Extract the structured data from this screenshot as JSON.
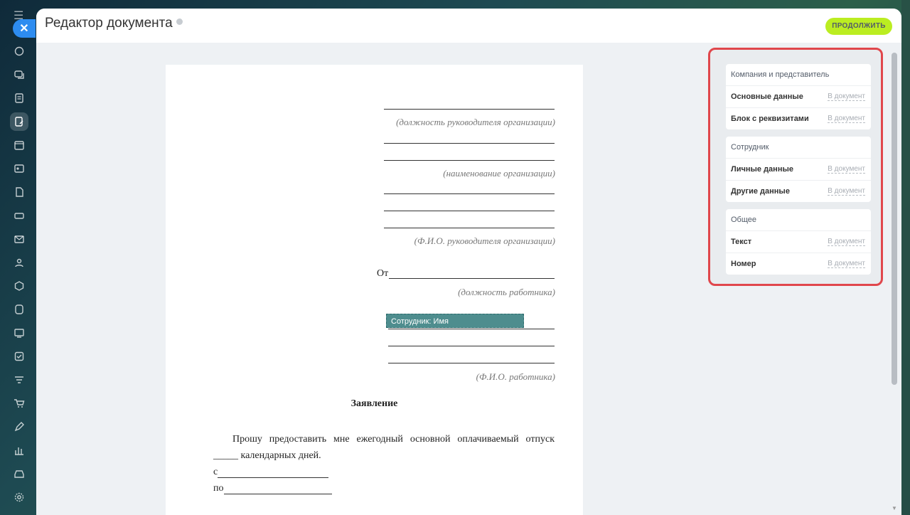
{
  "header": {
    "title": "Редактор документа",
    "continue_label": "ПРОДОЛЖИТЬ"
  },
  "rail": {
    "icons": [
      "compass-icon",
      "chat-icon",
      "tasks-icon",
      "documents-icon",
      "calendar-icon",
      "contacts-icon",
      "file-icon",
      "storage-icon",
      "mail-icon",
      "group-icon",
      "crm-icon",
      "sites-icon",
      "analytics-icon",
      "checklist-icon",
      "filter-icon",
      "cart-icon",
      "sign-icon",
      "bar-chart-icon",
      "inbox-icon",
      "settings-icon"
    ]
  },
  "document": {
    "captions": {
      "manager_position": "(должность руководителя организации)",
      "organization_name": "(наименование организации)",
      "manager_name": "(Ф.И.О. руководителя организации)",
      "employee_position": "(должность работника)",
      "employee_name": "(Ф.И.О. работника)"
    },
    "from_label": "От",
    "field_chip": "Сотрудник: Имя",
    "heading": "Заявление",
    "paragraph": "Прошу предоставить мне ежегодный основной оплачиваемый отпуск _____ календарных дней.",
    "from_date_prefix": "с",
    "to_date_prefix": "по"
  },
  "fields_panel": {
    "groups": [
      {
        "title": "Компания и представитель",
        "rows": [
          {
            "label": "Основные данные",
            "action": "В документ"
          },
          {
            "label": "Блок с реквизитами",
            "action": "В документ"
          }
        ]
      },
      {
        "title": "Сотрудник",
        "rows": [
          {
            "label": "Личные данные",
            "action": "В документ"
          },
          {
            "label": "Другие данные",
            "action": "В документ"
          }
        ]
      },
      {
        "title": "Общее",
        "rows": [
          {
            "label": "Текст",
            "action": "В документ"
          },
          {
            "label": "Номер",
            "action": "В документ"
          }
        ]
      }
    ]
  },
  "colors": {
    "accent_green": "#bbed21",
    "highlight_border": "#e0474c",
    "close_blue": "#2d8cf0",
    "chip_teal": "#4e8d8e"
  }
}
